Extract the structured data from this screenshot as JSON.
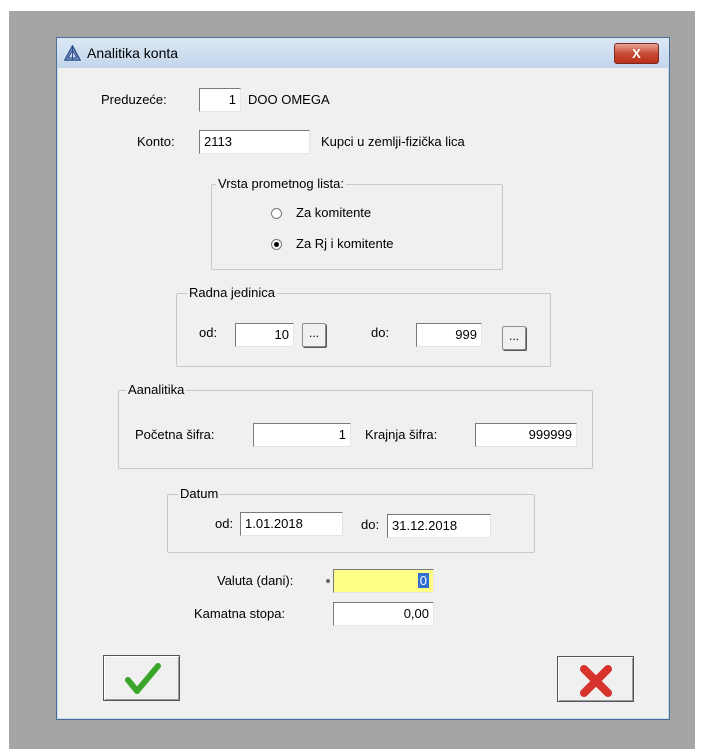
{
  "window": {
    "title": "Analitika konta",
    "close_glyph": "X"
  },
  "company": {
    "label": "Preduzeće:",
    "code": "1",
    "name": "DOO OMEGA"
  },
  "account": {
    "label": "Konto:",
    "value": "2113",
    "description": "Kupci  u zemlji-fizička lica"
  },
  "doc_type": {
    "legend": "Vrsta prometnog lista:",
    "options": [
      {
        "label": "Za komitente",
        "checked": false
      },
      {
        "label": "Za Rj i komitente",
        "checked": true
      }
    ]
  },
  "work_unit": {
    "legend": "Radna jedinica",
    "from_label": "od:",
    "from_value": "10",
    "to_label": "do:",
    "to_value": "999",
    "browse_label": "..."
  },
  "analytics": {
    "legend": "Aanalitika",
    "start_label": "Početna šifra:",
    "start_value": "1",
    "end_label": "Krajnja šifra:",
    "end_value": "999999"
  },
  "date": {
    "legend": "Datum",
    "from_label": "od:",
    "from_value": "1.01.2018",
    "to_label": "do:",
    "to_value": "31.12.2018"
  },
  "currency": {
    "label": "Valuta (dani):",
    "value": "0",
    "highlight_color": "#ffff88"
  },
  "interest": {
    "label": "Kamatna stopa:",
    "value": "0,00"
  },
  "colors": {
    "ok_check": "#3aa52a",
    "cancel_x": "#d8322c"
  }
}
